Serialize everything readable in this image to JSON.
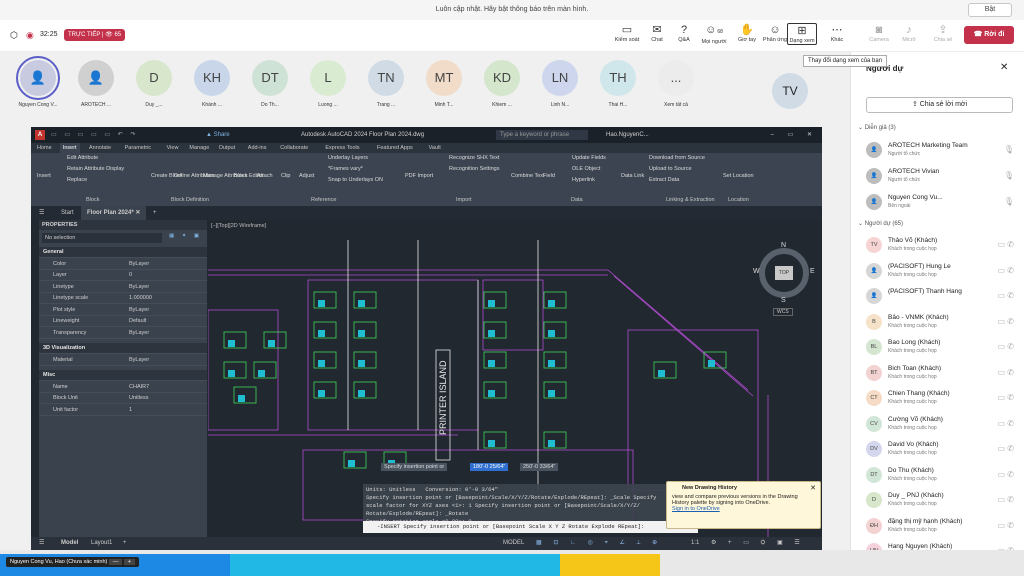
{
  "notice": {
    "text": "Luôn cập nhật. Hãy bật thông báo trên màn hình.",
    "button": "Bật"
  },
  "meeting": {
    "time": "32:25",
    "live_label": "TRỰC TIẾP",
    "viewers": "65",
    "leave": "Rời đi"
  },
  "toolbar": [
    {
      "label": "Kiểm soát",
      "icon": "control-icon"
    },
    {
      "label": "Chat",
      "icon": "chat-icon"
    },
    {
      "label": "Q&A",
      "icon": "qa-icon"
    },
    {
      "label": "Mọi người",
      "icon": "people-icon",
      "badge": "68"
    },
    {
      "label": "Giơ tay",
      "icon": "hand-icon"
    },
    {
      "label": "Phản ứng",
      "icon": "reaction-icon"
    },
    {
      "label": "Dạng xem",
      "icon": "view-icon"
    },
    {
      "label": "Khác",
      "icon": "more-icon"
    },
    {
      "label": "Camera",
      "icon": "camera-icon"
    },
    {
      "label": "Micrô",
      "icon": "mic-icon"
    },
    {
      "label": "Chia sẻ",
      "icon": "share-icon"
    }
  ],
  "tooltip": "Thay đổi dạng xem của bạn",
  "participants": [
    {
      "initials": "",
      "name": "Nguyen Cong V...",
      "color": "#c8cbe0"
    },
    {
      "initials": "",
      "name": "AROTECH ...",
      "color": "#d0d0d0"
    },
    {
      "initials": "D",
      "name": "Duy _...",
      "color": "#d8e6cc"
    },
    {
      "initials": "KH",
      "name": "Khánh ...",
      "color": "#c9d6ea"
    },
    {
      "initials": "DT",
      "name": "Do Th...",
      "color": "#cfe2d6"
    },
    {
      "initials": "L",
      "name": "Luong ...",
      "color": "#d9ebd0"
    },
    {
      "initials": "TN",
      "name": "Trang ...",
      "color": "#d0dbe6"
    },
    {
      "initials": "MT",
      "name": "Minh T...",
      "color": "#f0dcc8"
    },
    {
      "initials": "KD",
      "name": "Khiem ...",
      "color": "#d4e6cc"
    },
    {
      "initials": "LN",
      "name": "Linh N...",
      "color": "#cdd6ec"
    },
    {
      "initials": "TH",
      "name": "Thai H...",
      "color": "#cfe6ea"
    },
    {
      "initials": "...",
      "name": "Xem tất cả",
      "color": "#ececec"
    }
  ],
  "spotlight": {
    "initials": "TV"
  },
  "panel": {
    "title": "Người dự",
    "share_invite": "Chia sẻ lời mời",
    "presenters_header": "Diễn giả (3)",
    "attendees_header": "Người dự (65)",
    "presenters": [
      {
        "initials": "",
        "name": "AROTECH Marketing Team",
        "role": "Người tổ chức"
      },
      {
        "initials": "",
        "name": "AROTECH Vivian",
        "role": "Người tổ chức"
      },
      {
        "initials": "",
        "name": "Nguyen Cong Vu...",
        "role": "Bên ngoài"
      }
    ],
    "attendees": [
      {
        "initials": "TV",
        "name": "Thảo Võ (Khách)",
        "role": "Khách trong cuộc họp",
        "color": "#f6d4d4"
      },
      {
        "initials": "",
        "name": "(PACISOFT) Hung Le",
        "role": "Khách trong cuộc họp",
        "color": "#d6d6d6"
      },
      {
        "initials": "",
        "name": "(PACISOFT) Thanh Hang",
        "role": "",
        "color": "#d6d6d6"
      },
      {
        "initials": "B",
        "name": "Bảo - VNMK (Khách)",
        "role": "Khách trong cuộc họp",
        "color": "#f6e2c8"
      },
      {
        "initials": "BL",
        "name": "Bao Long (Khách)",
        "role": "Khách trong cuộc họp",
        "color": "#d4e6d0"
      },
      {
        "initials": "BT",
        "name": "Bich Toan (Khách)",
        "role": "Khách trong cuộc họp",
        "color": "#f3d2d2"
      },
      {
        "initials": "CT",
        "name": "Chien Thang (Khách)",
        "role": "Khách trong cuộc họp",
        "color": "#f6dcc6"
      },
      {
        "initials": "CV",
        "name": "Cường Võ (Khách)",
        "role": "Khách trong cuộc họp",
        "color": "#d2e6d8"
      },
      {
        "initials": "DV",
        "name": "David Vo (Khách)",
        "role": "Khách trong cuộc họp",
        "color": "#d4d6ee"
      },
      {
        "initials": "DT",
        "name": "Do Thu (Khách)",
        "role": "Khách trong cuộc họp",
        "color": "#d2e6d8"
      },
      {
        "initials": "D",
        "name": "Duy _ PNJ (Khách)",
        "role": "Khách trong cuộc họp",
        "color": "#d8e6cc"
      },
      {
        "initials": "ĐH",
        "name": "đặng thị mỹ hạnh (Khách)",
        "role": "Khách trong cuộc họp",
        "color": "#f3d2d2"
      },
      {
        "initials": "HN",
        "name": "Hang Nguyen (Khách)",
        "role": "Khách trong cuộc họp",
        "color": "#f3d2dc"
      }
    ]
  },
  "acad": {
    "title": "Autodesk AutoCAD 2024   Floor Plan 2024.dwg",
    "search": "Type a keyword or phrase",
    "user": "Hao.NguyenC...",
    "share": "Share",
    "tabs": [
      "Home",
      "Insert",
      "Annotate",
      "Parametric",
      "View",
      "Manage",
      "Output",
      "Add-ins",
      "Collaborate",
      "Express Tools",
      "Featured Apps",
      "Vault"
    ],
    "ribbon_items": [
      "Edit Attribute",
      "Retain Attribute Display",
      "Replace",
      "Create Block",
      "Define Attributes",
      "Manage Attributes",
      "Block Editor",
      "Attach",
      "Clip",
      "Adjust",
      "Underlay Layers",
      "*Frames vary*",
      "Snap to Underlays ON",
      "PDF Import",
      "Recognize SHX Text",
      "Recognition Settings",
      "Combine Text",
      "Field",
      "Update Fields",
      "OLE Object",
      "Hyperlink",
      "Data Link",
      "Download from Source",
      "Upload to Source",
      "Extract Data",
      "Set Location",
      "Insert"
    ],
    "panels": [
      "Block",
      "Block Definition",
      "Reference",
      "Import",
      "Data",
      "Linking & Extraction",
      "Location"
    ],
    "file_tabs": [
      "Start",
      "Floor Plan 2024*"
    ],
    "view_label": "[−][Top][2D Wireframe]",
    "properties_title": "PROPERTIES",
    "selection": "No selection",
    "props": [
      {
        "section": "General"
      },
      {
        "k": "Color",
        "v": "ByLayer"
      },
      {
        "k": "Layer",
        "v": "0"
      },
      {
        "k": "Linetype",
        "v": "ByLayer"
      },
      {
        "k": "Linetype scale",
        "v": "1.000000"
      },
      {
        "k": "Plot style",
        "v": "ByLayer"
      },
      {
        "k": "Lineweight",
        "v": "Default"
      },
      {
        "k": "Transparency",
        "v": "ByLayer"
      },
      {
        "section": "3D Visualization"
      },
      {
        "k": "Material",
        "v": "ByLayer"
      },
      {
        "section": "Misc"
      },
      {
        "k": "Name",
        "v": "CHAIR7"
      },
      {
        "k": "Block Unit",
        "v": "Unitless"
      },
      {
        "k": "Unit factor",
        "v": "1"
      }
    ],
    "cmd_history": "Units: Unitless   Conversion: 0'-0 3/64\"\nSpecify insertion point or [Basepoint/Scale/X/Y/Z/Rotate/Explode/REpeat]: _Scale Specify\nscale factor for XYZ axes <1>: 1 Specify insertion point or [Basepoint/Scale/X/Y/Z/\nRotate/Explode/REpeat]: _Rotate\nSpecify rotation angle <0.00>: 0",
    "cmd_line": "-INSERT Specify insertion point or [Basepoint Scale X Y Z Rotate Explode REpeat]:",
    "cursor_prompt": "Specify insertion point or",
    "cursor_x": "180'-0 25/64\"",
    "cursor_y": "250'-0 33/64\"",
    "tip_title": "New Drawing History",
    "tip_body": "view and compare previous versions in the Drawing History palette by signing into OneDrive.",
    "tip_link": "Sign in to OneDrive",
    "layout_tabs": [
      "Model",
      "Layout1"
    ],
    "status_model": "MODEL",
    "status_scale": "1:1",
    "plan_labels": [
      "PRINTER ISLAND"
    ],
    "compass": [
      "N",
      "S",
      "E",
      "W",
      "TOP"
    ],
    "wcs": "WCS"
  },
  "presenter_tag": "Nguyen Cong Vu, Hao (Chưa xác minh)"
}
